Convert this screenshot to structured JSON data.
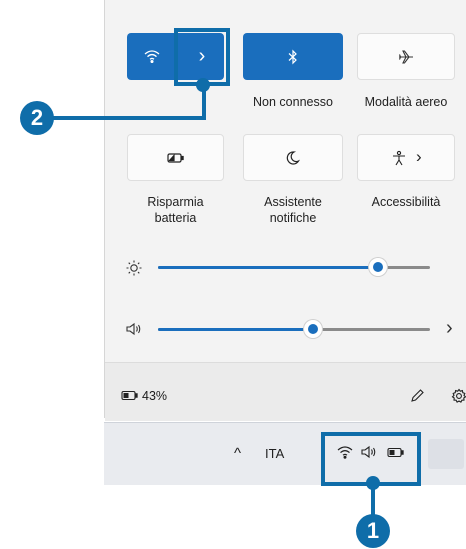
{
  "quick_settings": {
    "tiles_row1": [
      {
        "id": "wifi",
        "label": "",
        "state": "on"
      },
      {
        "id": "bluetooth",
        "label": "Non connesso",
        "state": "on"
      },
      {
        "id": "airplane",
        "label": "Modalità aereo",
        "state": "off"
      }
    ],
    "tiles_row2": [
      {
        "id": "battery-saver",
        "label_line1": "Risparmia",
        "label_line2": "batteria"
      },
      {
        "id": "focus-assist",
        "label_line1": "Assistente",
        "label_line2": "notifiche"
      },
      {
        "id": "accessibility",
        "label_line1": "Accessibilità",
        "label_line2": ""
      }
    ],
    "wifi_expand_glyph": "›",
    "accessibility_glyph": "›",
    "brightness_level": 0.81,
    "volume_level": 0.57,
    "volume_more_glyph": "›"
  },
  "footer": {
    "battery_text": "43%"
  },
  "taskbar": {
    "up_arrow_glyph": "^",
    "language": "ITA"
  },
  "callouts": {
    "one": "1",
    "two": "2"
  },
  "colors": {
    "accent": "#1a6ebd",
    "callout": "#0f6da9"
  },
  "icons": [
    "wifi-icon",
    "bluetooth-icon",
    "airplane-icon",
    "battery-saver-icon",
    "moon-icon",
    "accessibility-icon",
    "brightness-icon",
    "volume-icon",
    "battery-icon",
    "pencil-icon",
    "gear-icon"
  ]
}
